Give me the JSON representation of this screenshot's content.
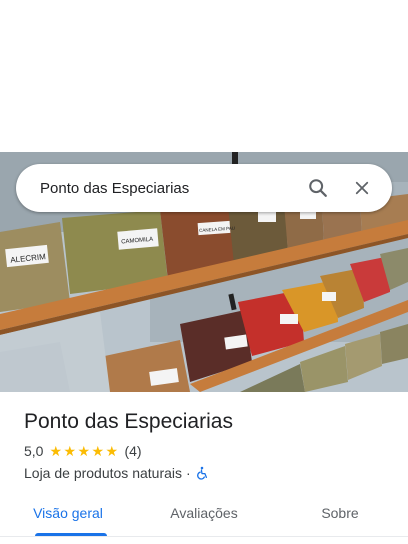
{
  "search": {
    "value": "Ponto das Especiarias"
  },
  "photo": {
    "labels": [
      "ALECRIM",
      "CAMOMILA",
      "CANELA EM PAU"
    ]
  },
  "place": {
    "title": "Ponto das Especiarias",
    "rating": "5,0",
    "stars": 5,
    "review_count": "(4)",
    "category": "Loja de produtos naturais",
    "separator": "·"
  },
  "tabs": [
    {
      "label": "Visão geral",
      "active": true
    },
    {
      "label": "Avaliações",
      "active": false
    },
    {
      "label": "Sobre",
      "active": false
    }
  ],
  "colors": {
    "accent": "#1a73e8",
    "star": "#fbbc04",
    "shelf": "#c67c3c",
    "a11y_icon": "#1a73e8"
  },
  "icons": {
    "search": "search-icon",
    "close": "close-icon",
    "star": "star-icon",
    "accessibility": "wheelchair-icon"
  }
}
